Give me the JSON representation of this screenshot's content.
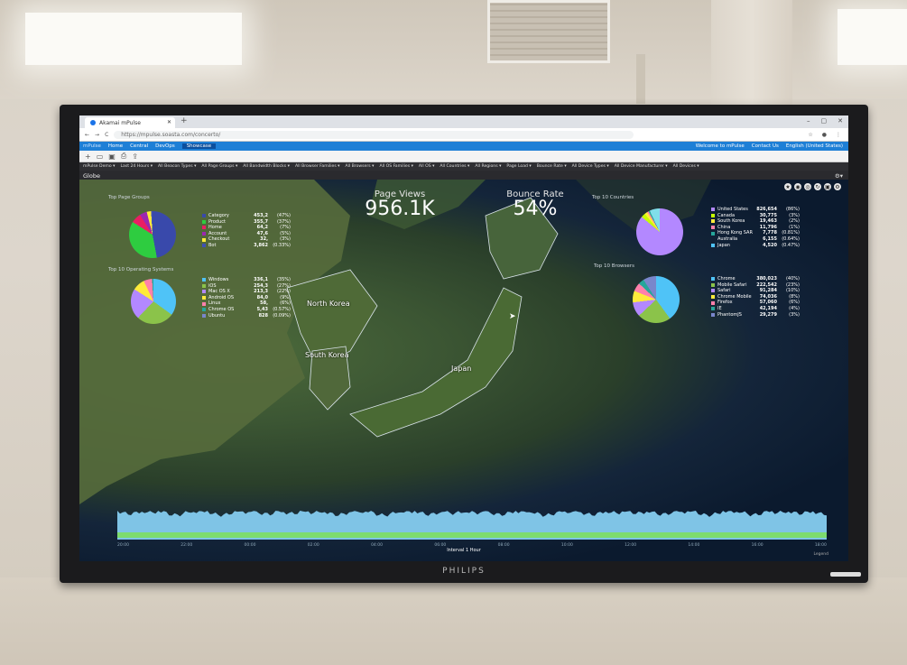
{
  "browser": {
    "tab_title": "Akamai mPulse",
    "url": "https://mpulse.soasta.com/concerto/",
    "window_controls": [
      "–",
      "▢",
      "✕"
    ]
  },
  "app_nav": {
    "brand": "mPulse",
    "items": [
      "Home",
      "Central",
      "DevOps",
      "Showcase"
    ],
    "active": "Showcase",
    "right_items": [
      "Welcome to mPulse",
      "Contact Us",
      "English (United States)"
    ]
  },
  "filters": [
    "mPulse Demo ▾",
    "Last 24 Hours ▾",
    "All Beacon Types ▾",
    "All Page Groups ▾",
    "All Bandwidth Blocks ▾",
    "All Browser Families ▾",
    "All Browsers ▾",
    "All OS Families ▾",
    "All OS ▾",
    "All Countries ▾",
    "All Regions ▾",
    "Page Load ▾",
    "Bounce Rate ▾",
    "All Device Types ▾",
    "All Device Manufacturer ▾",
    "All Devices ▾"
  ],
  "view_title": "Globe",
  "kpis": {
    "page_views_label": "Page Views",
    "page_views_value": "956.1K",
    "bounce_rate_label": "Bounce Rate",
    "bounce_rate_value": "54%"
  },
  "map_labels": {
    "north_korea": "North Korea",
    "south_korea": "South Korea",
    "japan": "Japan"
  },
  "panels": {
    "page_groups": {
      "title": "Top Page Groups",
      "items": [
        {
          "name": "Category",
          "value": "453,2",
          "pct": "(47%)",
          "color": "#3949ab"
        },
        {
          "name": "Product",
          "value": "355,7",
          "pct": "(37%)",
          "color": "#2ecc40"
        },
        {
          "name": "Home",
          "value": "64,2",
          "pct": "(7%)",
          "color": "#e91e63"
        },
        {
          "name": "Account",
          "value": "47,6",
          "pct": "(5%)",
          "color": "#9c27b0"
        },
        {
          "name": "Checkout",
          "value": "32,",
          "pct": "(3%)",
          "color": "#ffeb3b"
        },
        {
          "name": "Bot",
          "value": "3,862",
          "pct": "(0.33%)",
          "color": "#3f51b5"
        }
      ]
    },
    "operating_systems": {
      "title": "Top 10 Operating Systems",
      "items": [
        {
          "name": "Windows",
          "value": "336,1",
          "pct": "(35%)",
          "color": "#4fc3f7"
        },
        {
          "name": "iOS",
          "value": "254,3",
          "pct": "(27%)",
          "color": "#8bc34a"
        },
        {
          "name": "Mac OS X",
          "value": "213,3",
          "pct": "(22%)",
          "color": "#b388ff"
        },
        {
          "name": "Android OS",
          "value": "84,0",
          "pct": "(9%)",
          "color": "#ffeb3b"
        },
        {
          "name": "Linux",
          "value": "58,",
          "pct": "(6%)",
          "color": "#ff80ab"
        },
        {
          "name": "Chrome OS",
          "value": "5,43",
          "pct": "(0.57%)",
          "color": "#26a69a"
        },
        {
          "name": "Ubuntu",
          "value": "828",
          "pct": "(0.09%)",
          "color": "#7986cb"
        }
      ]
    },
    "countries": {
      "title": "Top 10 Countries",
      "items": [
        {
          "name": "United States",
          "value": "826,654",
          "pct": "(86%)",
          "color": "#b388ff"
        },
        {
          "name": "Canada",
          "value": "30,775",
          "pct": "(3%)",
          "color": "#c6ff00"
        },
        {
          "name": "South Korea",
          "value": "19,463",
          "pct": "(2%)",
          "color": "#ffeb3b"
        },
        {
          "name": "China",
          "value": "11,796",
          "pct": "(1%)",
          "color": "#ff80ab"
        },
        {
          "name": "Hong Kong SAR",
          "value": "7,778",
          "pct": "(0.81%)",
          "color": "#26a69a"
        },
        {
          "name": "Australia",
          "value": "6,155",
          "pct": "(0.64%)",
          "color": "#00000000"
        },
        {
          "name": "Japan",
          "value": "4,520",
          "pct": "(0.47%)",
          "color": "#4fc3f7"
        }
      ]
    },
    "browsers": {
      "title": "Top 10 Browsers",
      "items": [
        {
          "name": "Chrome",
          "value": "380,023",
          "pct": "(40%)",
          "color": "#4fc3f7"
        },
        {
          "name": "Mobile Safari",
          "value": "222,542",
          "pct": "(23%)",
          "color": "#8bc34a"
        },
        {
          "name": "Safari",
          "value": "91,284",
          "pct": "(10%)",
          "color": "#b388ff"
        },
        {
          "name": "Chrome Mobile",
          "value": "74,036",
          "pct": "(8%)",
          "color": "#ffeb3b"
        },
        {
          "name": "Firefox",
          "value": "57,060",
          "pct": "(6%)",
          "color": "#ff80ab"
        },
        {
          "name": "IE",
          "value": "42,194",
          "pct": "(4%)",
          "color": "#26a69a"
        },
        {
          "name": "PhantomJS",
          "value": "29,279",
          "pct": "(3%)",
          "color": "#7986cb"
        }
      ]
    }
  },
  "pie_slices": {
    "page_groups": [
      47,
      37,
      7,
      5,
      3,
      1
    ],
    "operating_systems": [
      35,
      27,
      22,
      9,
      6,
      1
    ],
    "countries": [
      86,
      3,
      2,
      1,
      1,
      7
    ],
    "browsers": [
      40,
      23,
      10,
      8,
      6,
      4,
      9
    ]
  },
  "timeline": {
    "axis_labels": [
      "20:00",
      "22:00",
      "00:00",
      "02:00",
      "04:00",
      "06:00",
      "08:00",
      "10:00",
      "12:00",
      "14:00",
      "16:00",
      "18:00"
    ],
    "interval_label": "Interval",
    "interval_value": "1 Hour",
    "legend_button": "Legend"
  },
  "tv_brand": "PHILIPS",
  "accent_colors": {
    "navbar": "#1e7fd6",
    "active_nav": "#0b4f9e"
  }
}
